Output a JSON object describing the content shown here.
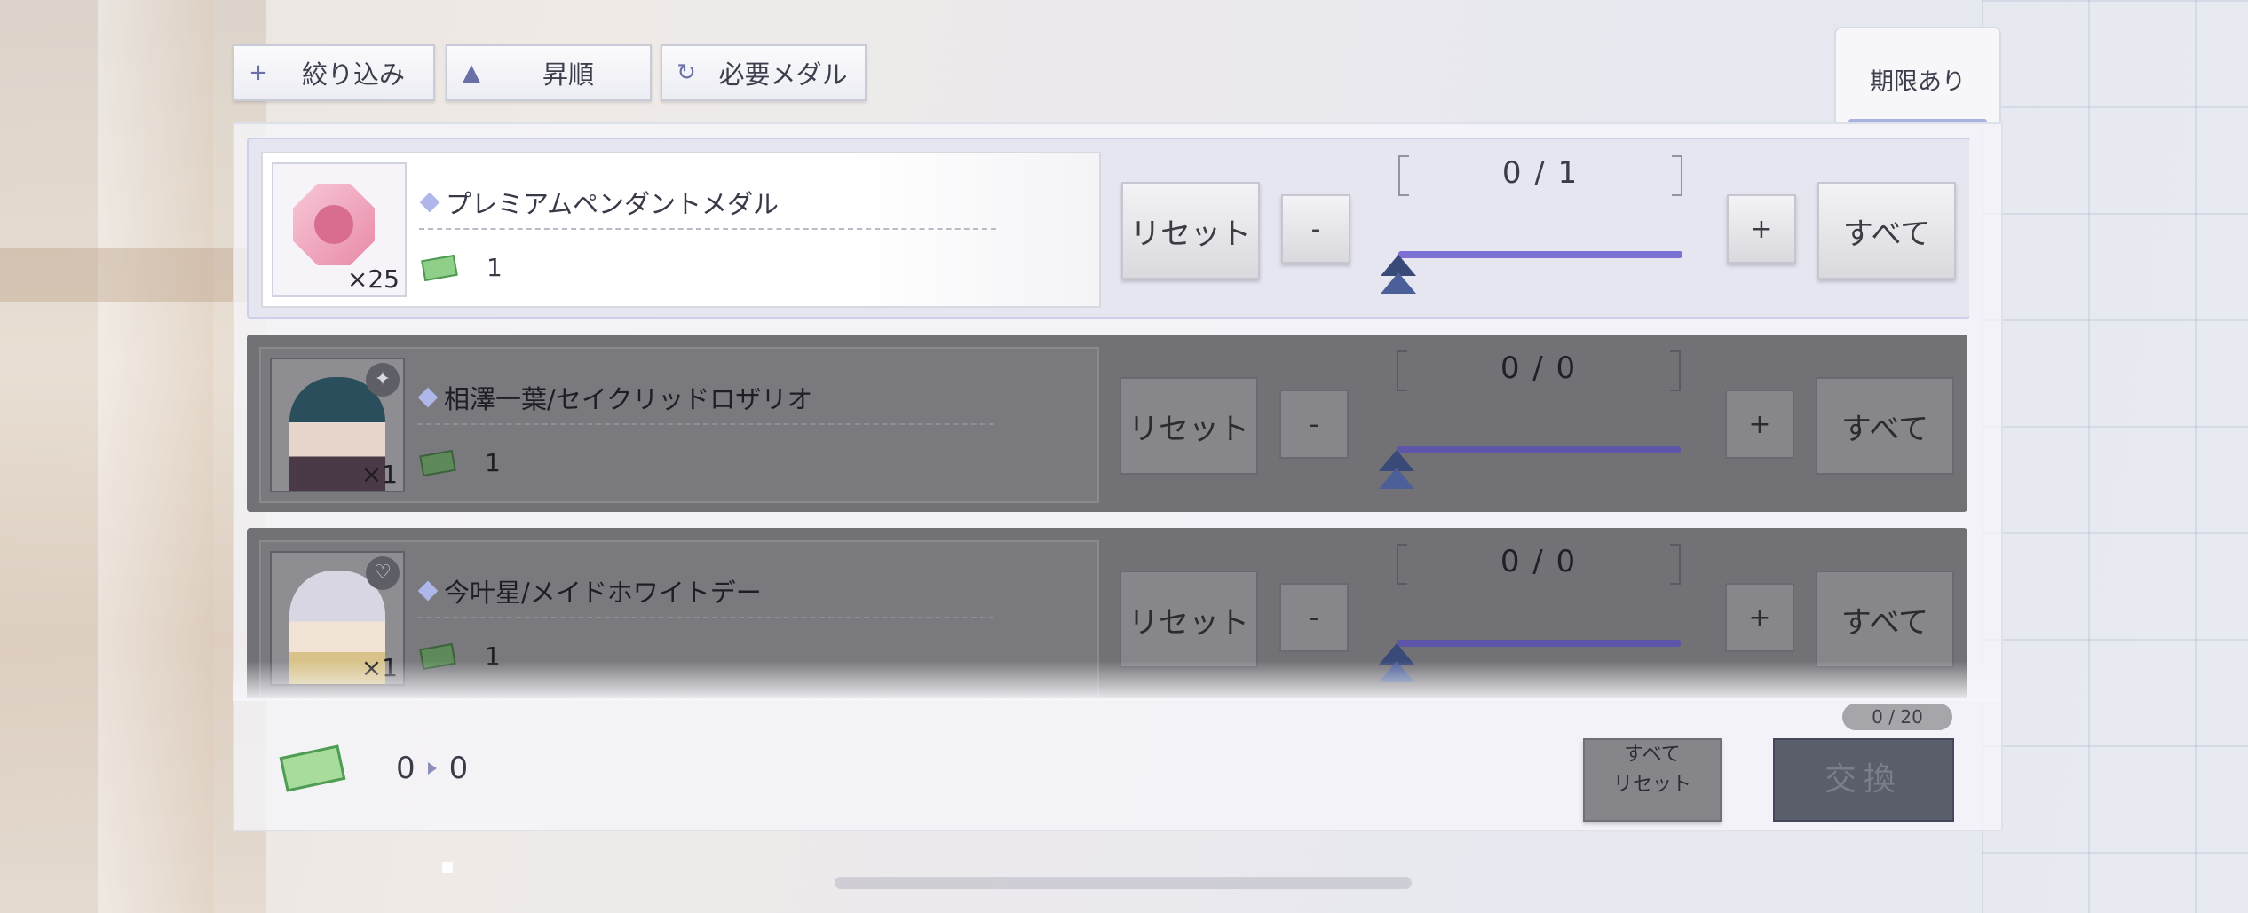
{
  "filters": [
    {
      "icon": "plus-icon",
      "glyph": "+",
      "label": "絞り込み"
    },
    {
      "icon": "sort-ascending-icon",
      "glyph": "▲",
      "label": "昇順"
    },
    {
      "icon": "refresh-icon",
      "glyph": "↻",
      "label": "必要メダル"
    }
  ],
  "tab": {
    "label": "期限あり"
  },
  "items": [
    {
      "name": "プレミアムペンダントメダル",
      "qty": "×25",
      "cost": "1",
      "count": "0 / 1",
      "reset": "リセット",
      "minus": "-",
      "plus": "+",
      "all": "すべて",
      "state": "active"
    },
    {
      "name": "相澤一葉/セイクリッドロザリオ",
      "qty": "×1",
      "cost": "1",
      "count": "0 / 0",
      "reset": "リセット",
      "minus": "-",
      "plus": "+",
      "all": "すべて",
      "state": "disabled"
    },
    {
      "name": "今叶星/メイドホワイトデー",
      "qty": "×1",
      "cost": "1",
      "count": "0 / 0",
      "reset": "リセット",
      "minus": "-",
      "plus": "+",
      "all": "すべて",
      "state": "disabled"
    }
  ],
  "footer": {
    "total_current": "0",
    "total_after": "0",
    "selection_count": "0 / 20",
    "reset_all_line1": "すべて",
    "reset_all_line2": "リセット",
    "exchange": "交換"
  },
  "colors": {
    "slider": "#7b70d4",
    "disabled_row": "#727276",
    "exchange_disabled": "#5a5d6a"
  }
}
